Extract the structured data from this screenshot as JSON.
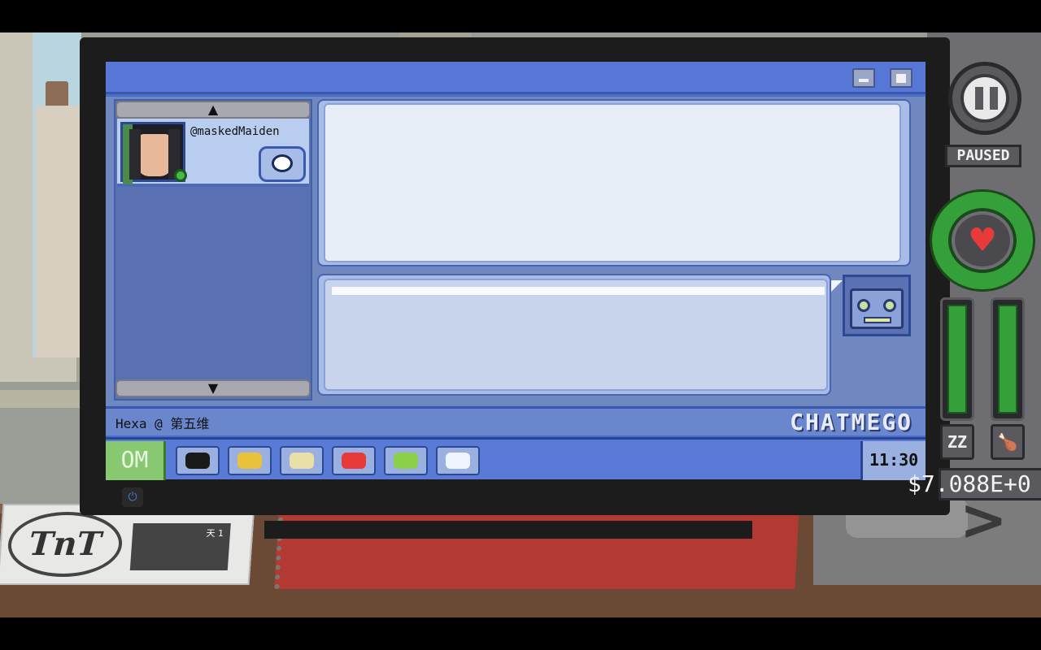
{
  "contacts": {
    "items": [
      {
        "handle": "@maskedMaiden",
        "status": "online"
      }
    ]
  },
  "status_bar": {
    "user_label": "Hexa @ 第五维",
    "app_name": "CHATMEGO"
  },
  "taskbar": {
    "start_label": "OM",
    "icons": [
      {
        "name": "user-icon",
        "color": "#1a1a1a"
      },
      {
        "name": "tag-icon",
        "color": "#e8c238"
      },
      {
        "name": "calendar-icon",
        "color": "#e8e0a8"
      },
      {
        "name": "mail-icon",
        "color": "#e83a3a"
      },
      {
        "name": "money-icon",
        "color": "#8ad048"
      },
      {
        "name": "chat-icon",
        "color": "#f0f4fc"
      }
    ],
    "clock": "11:30"
  },
  "hud": {
    "pause_label": "PAUSED",
    "money": "$7.088E+0",
    "sleep_icon": "ZZ",
    "health_level": 1.0,
    "sleep_level": 1.0,
    "hunger_level": 1.0
  },
  "desk": {
    "newspaper_logo": "TnT",
    "newspaper_day": "天 1"
  }
}
